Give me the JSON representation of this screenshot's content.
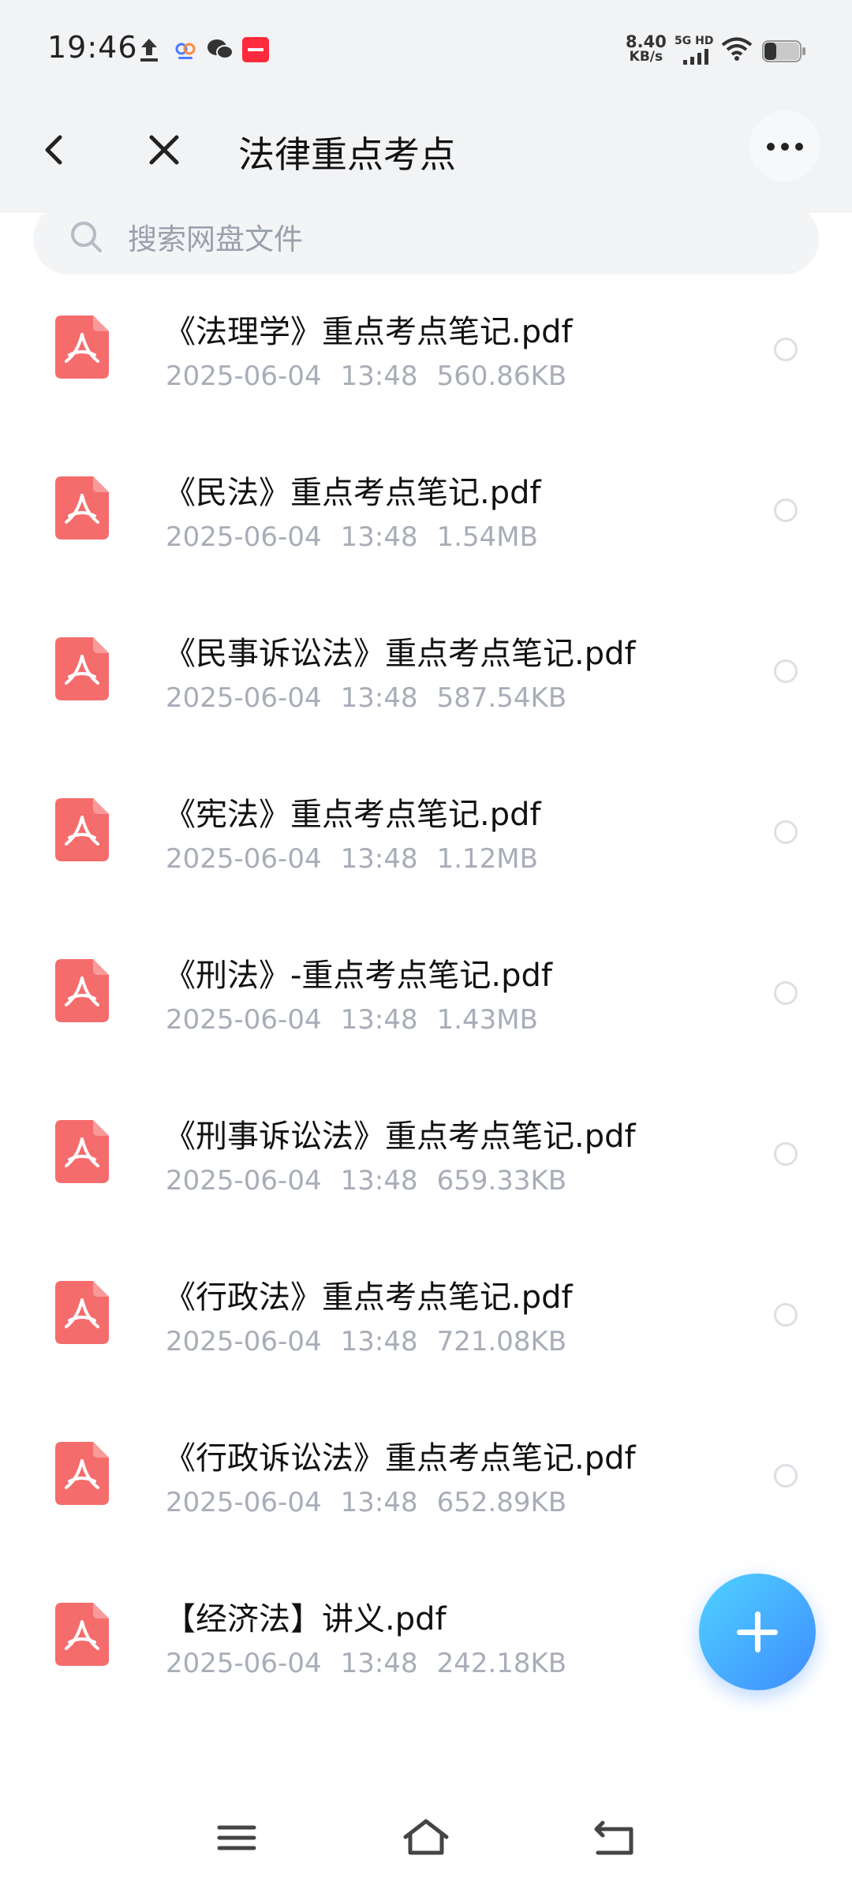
{
  "status_bar": {
    "time": "19:46",
    "net_speed_value": "8.40",
    "net_speed_unit": "KB/s",
    "network_type": "5G HD"
  },
  "header": {
    "title": "法律重点考点"
  },
  "search": {
    "placeholder": "搜索网盘文件"
  },
  "files": [
    {
      "name": "《法理学》重点考点笔记.pdf",
      "date": "2025-06-04",
      "time": "13:48",
      "size": "560.86KB"
    },
    {
      "name": "《民法》重点考点笔记.pdf",
      "date": "2025-06-04",
      "time": "13:48",
      "size": "1.54MB"
    },
    {
      "name": "《民事诉讼法》重点考点笔记.pdf",
      "date": "2025-06-04",
      "time": "13:48",
      "size": "587.54KB"
    },
    {
      "name": "《宪法》重点考点笔记.pdf",
      "date": "2025-06-04",
      "time": "13:48",
      "size": "1.12MB"
    },
    {
      "name": "《刑法》-重点考点笔记.pdf",
      "date": "2025-06-04",
      "time": "13:48",
      "size": "1.43MB"
    },
    {
      "name": "《刑事诉讼法》重点考点笔记.pdf",
      "date": "2025-06-04",
      "time": "13:48",
      "size": "659.33KB"
    },
    {
      "name": "《行政法》重点考点笔记.pdf",
      "date": "2025-06-04",
      "time": "13:48",
      "size": "721.08KB"
    },
    {
      "name": "《行政诉讼法》重点考点笔记.pdf",
      "date": "2025-06-04",
      "time": "13:48",
      "size": "652.89KB"
    },
    {
      "name": "【经济法】讲义.pdf",
      "date": "2025-06-04",
      "time": "13:48",
      "size": "242.18KB"
    }
  ],
  "colors": {
    "pdf_icon": "#f56c6c",
    "fab_start": "#4fd2ff",
    "fab_end": "#3f8cff",
    "meta_text": "#a8adb8"
  }
}
